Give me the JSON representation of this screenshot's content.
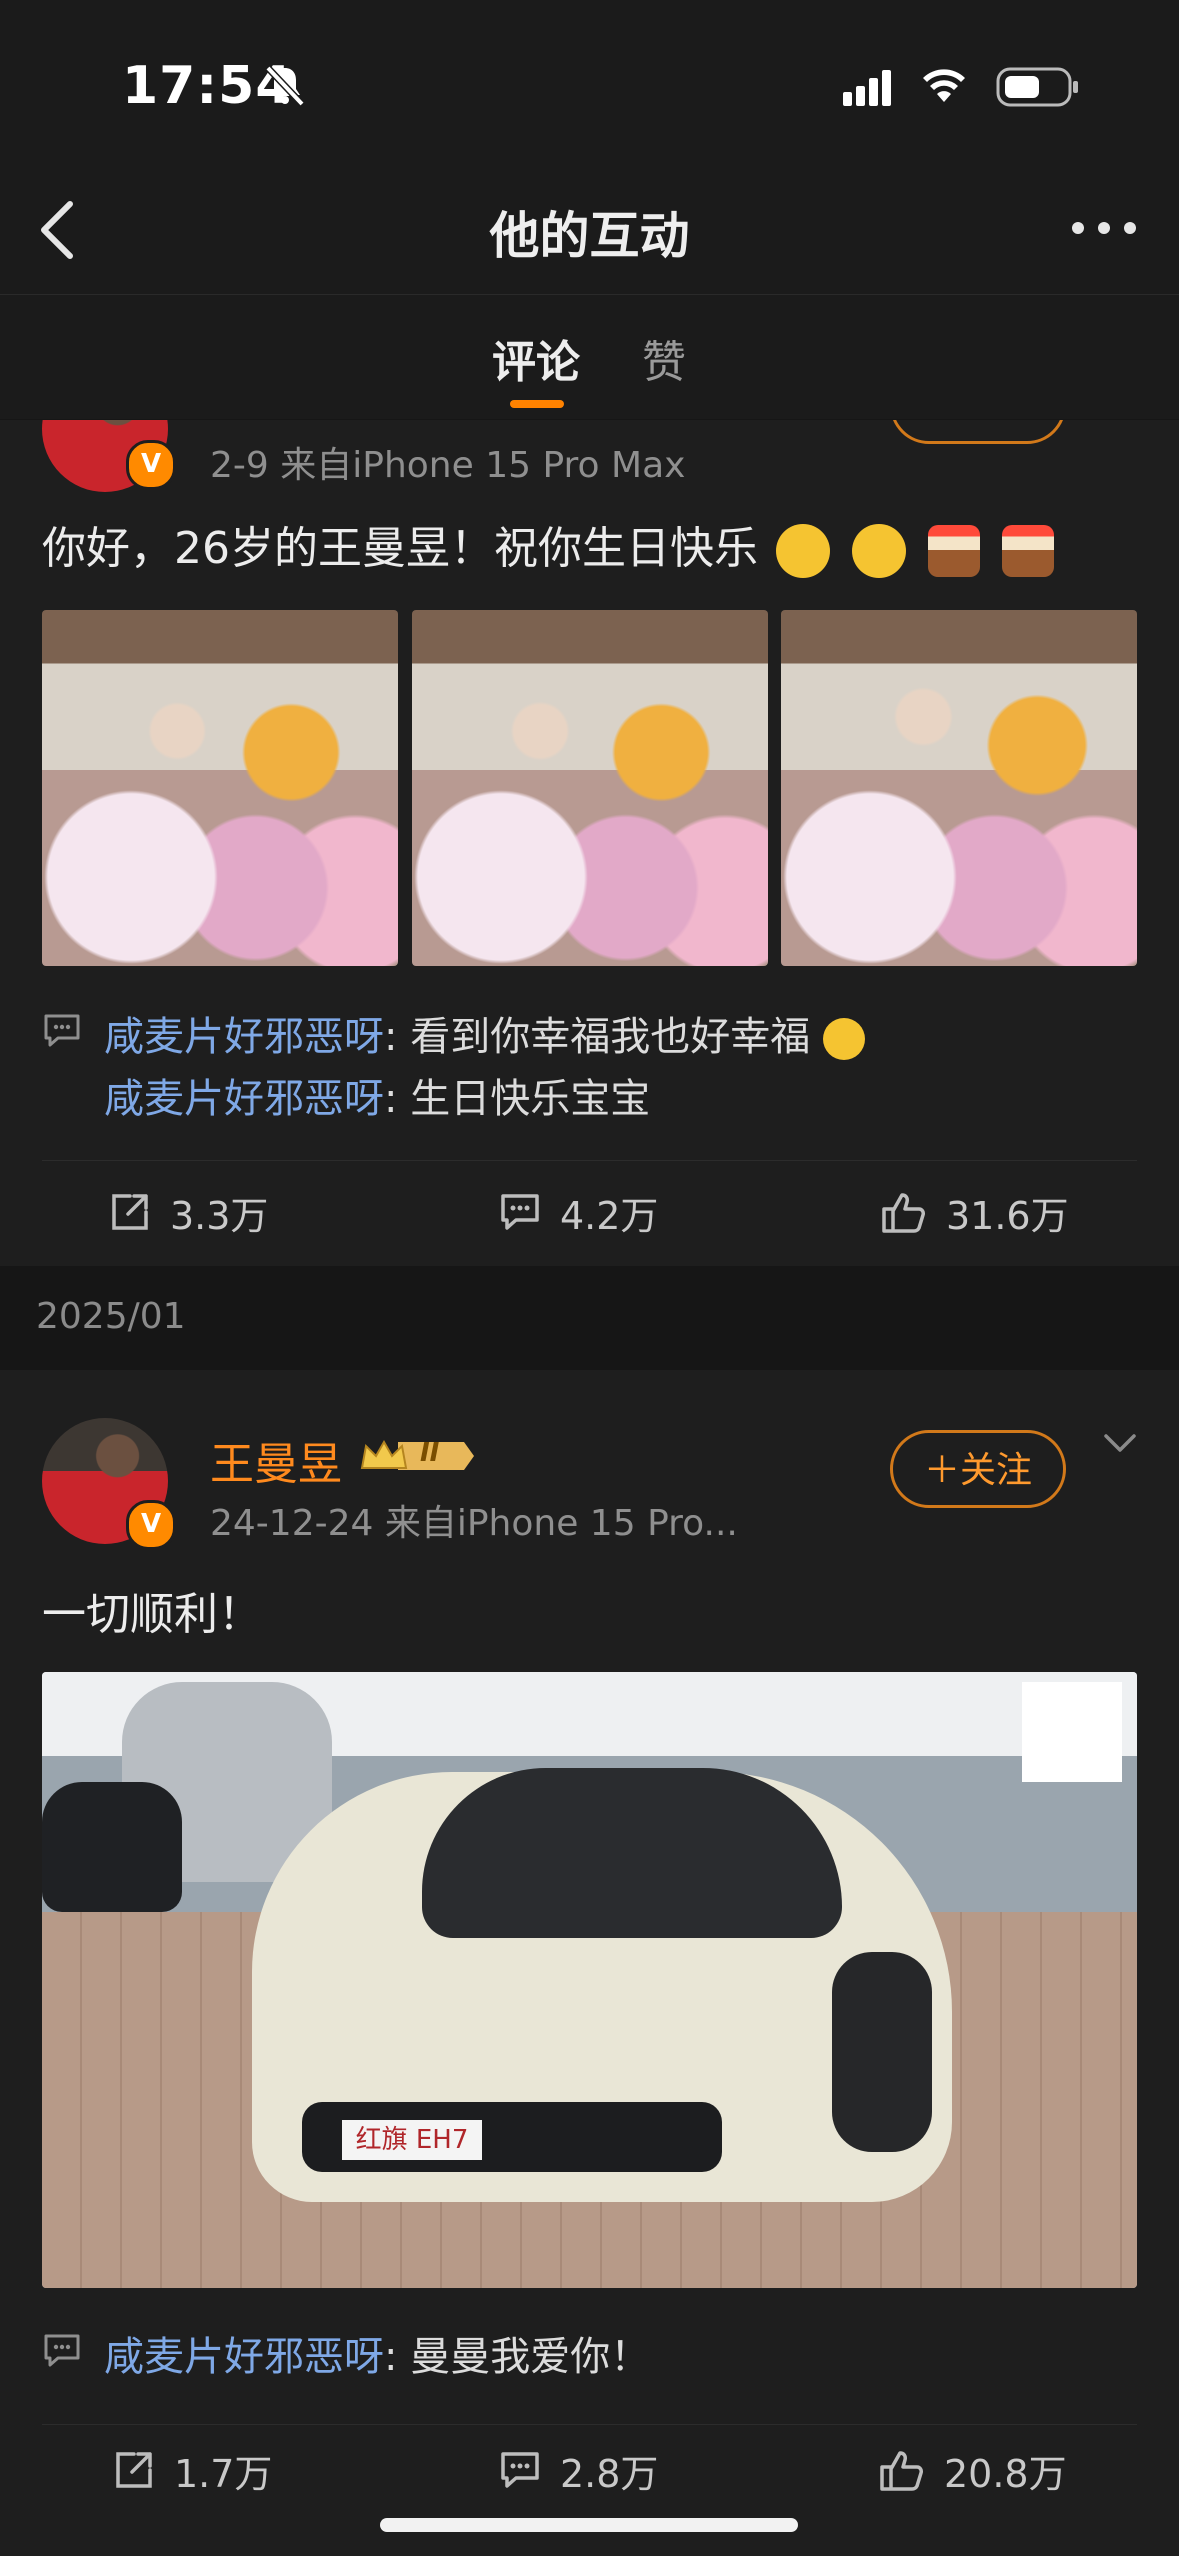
{
  "status_bar": {
    "time": "17:54"
  },
  "nav": {
    "title": "他的互动"
  },
  "tabs": [
    {
      "label": "评论"
    },
    {
      "label": "赞"
    }
  ],
  "posts": [
    {
      "meta": "2-9  来自iPhone 15 Pro Max",
      "text": "你好，26岁的王曼昱！祝你生日快乐",
      "comments": [
        {
          "user": "咸麦片好邪恶呀",
          "text": ": 看到你幸福我也好幸福"
        },
        {
          "user": "咸麦片好邪恶呀",
          "text": ": 生日快乐宝宝"
        }
      ],
      "reposts": "3.3万",
      "comment_count": "4.2万",
      "likes": "31.6万"
    },
    {
      "name": "王曼昱",
      "level_badge": "II",
      "meta": "24-12-24  来自iPhone 15 Pro...",
      "follow_label": "＋关注",
      "text": "一切顺利！",
      "car_plate": "红旗 EH7",
      "comments": [
        {
          "user": "咸麦片好邪恶呀",
          "text": ": 曼曼我爱你！"
        }
      ],
      "reposts": "1.7万",
      "comment_count": "2.8万",
      "likes": "20.8万"
    }
  ],
  "month_divider": "2025/01",
  "colors": {
    "accent": "#ff8200",
    "link": "#7fa8e6",
    "background": "#161616"
  }
}
